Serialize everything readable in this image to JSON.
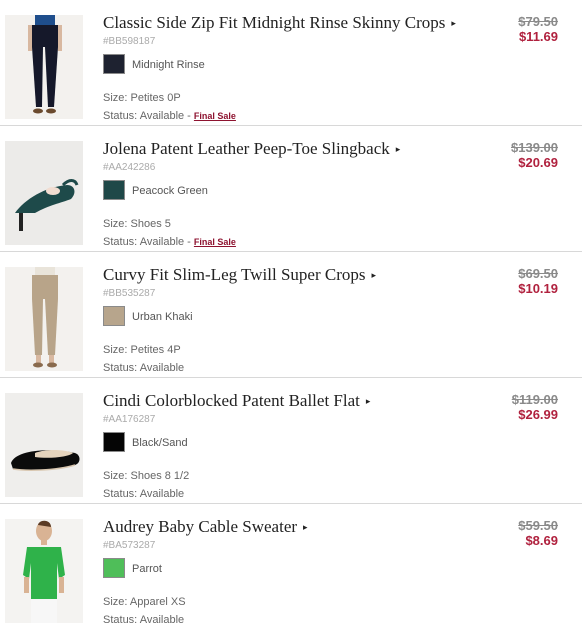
{
  "items": [
    {
      "title": "Classic Side Zip Fit Midnight Rinse Skinny Crops",
      "arrow": "▸",
      "sku": "#BB598187",
      "color_name": "Midnight Rinse",
      "swatch_color": "#1e2230",
      "size": "Size: Petites 0P",
      "status": "Status: Available - ",
      "final_sale": "Final Sale",
      "price_old": "$79.50",
      "price_new": "$11.69",
      "image_icon": "skinny-crops-photo"
    },
    {
      "title": "Jolena Patent Leather Peep-Toe Slingback",
      "arrow": "▸",
      "sku": "#AA242286",
      "color_name": "Peacock Green",
      "swatch_color": "#1f4848",
      "size": "Size: Shoes 5",
      "status": "Status: Available - ",
      "final_sale": "Final Sale",
      "price_old": "$139.00",
      "price_new": "$20.69",
      "image_icon": "slingback-shoe-photo"
    },
    {
      "title": "Curvy Fit Slim-Leg Twill Super Crops",
      "arrow": "▸",
      "sku": "#BB535287",
      "color_name": "Urban Khaki",
      "swatch_color": "#b7a58c",
      "size": "Size: Petites 4P",
      "status": "Status: Available",
      "final_sale": "",
      "price_old": "$69.50",
      "price_new": "$10.19",
      "image_icon": "twill-crops-photo"
    },
    {
      "title": "Cindi Colorblocked Patent Ballet Flat",
      "arrow": "▸",
      "sku": "#AA176287",
      "color_name": "Black/Sand",
      "swatch_color": "#050505",
      "size": "Size: Shoes 8 1/2",
      "status": "Status: Available",
      "final_sale": "",
      "price_old": "$119.00",
      "price_new": "$26.99",
      "image_icon": "ballet-flat-photo"
    },
    {
      "title": "Audrey Baby Cable Sweater",
      "arrow": "▸",
      "sku": "#BA573287",
      "color_name": "Parrot",
      "swatch_color": "#4fbe59",
      "size": "Size: Apparel XS",
      "status": "Status: Available",
      "final_sale": "",
      "price_old": "$59.50",
      "price_new": "$8.69",
      "image_icon": "cable-sweater-photo"
    }
  ]
}
